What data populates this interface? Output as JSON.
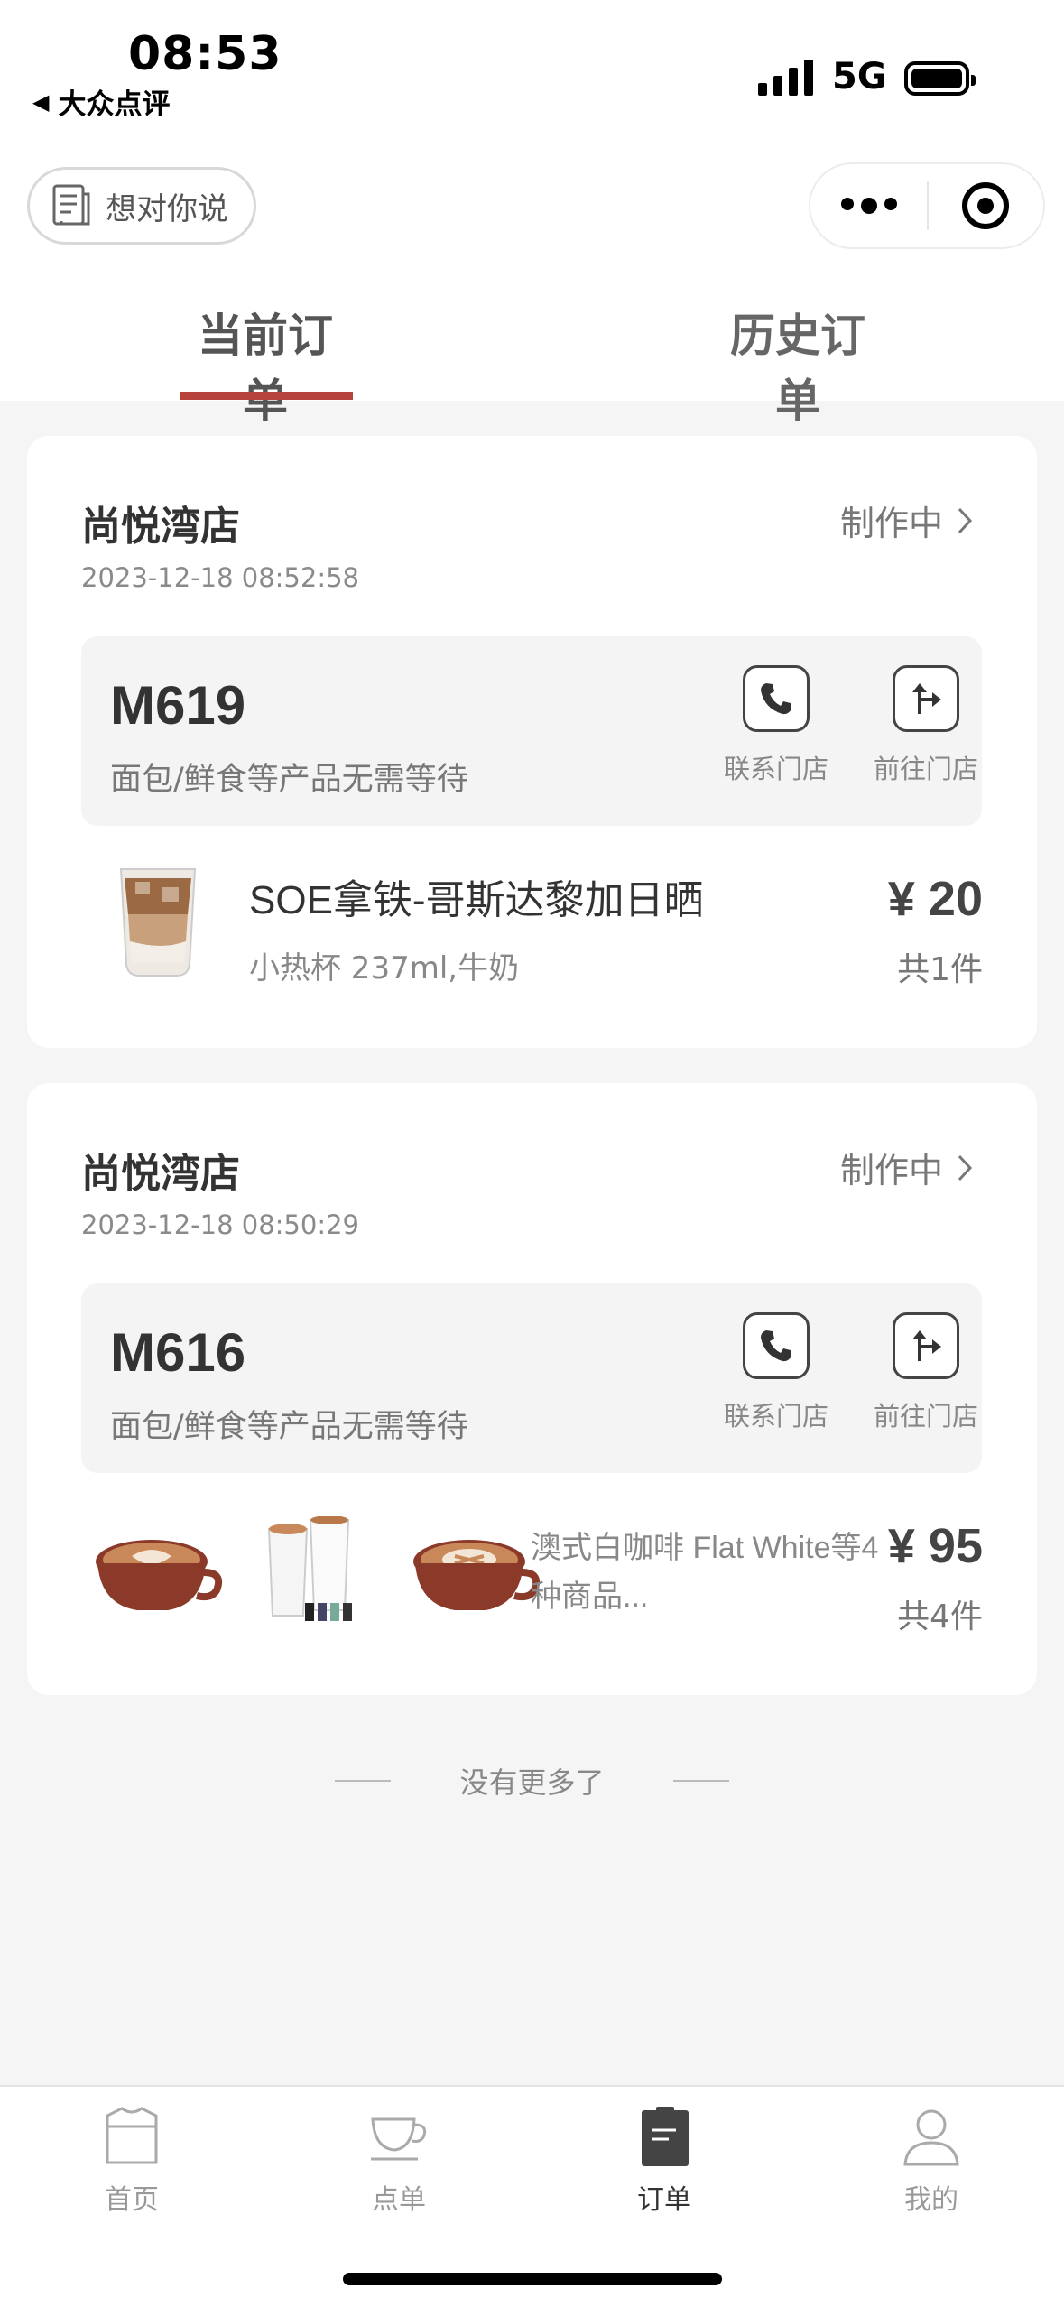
{
  "status_bar": {
    "time": "08:53",
    "back_app": "大众点评",
    "network": "5G"
  },
  "header": {
    "feedback_label": "想对你说"
  },
  "tabs": [
    {
      "label": "当前订单",
      "active": true
    },
    {
      "label": "历史订单",
      "active": false
    }
  ],
  "orders": [
    {
      "store": "尚悦湾店",
      "time": "2023-12-18 08:52:58",
      "status": "制作中",
      "code": "M619",
      "note": "面包/鲜食等产品无需等待",
      "call_label": "联系门店",
      "nav_label": "前往门店",
      "item_name": "SOE拿铁-哥斯达黎加日晒",
      "item_spec": "小热杯 237ml,牛奶",
      "price": "¥ 20",
      "qty": "共1件"
    },
    {
      "store": "尚悦湾店",
      "time": "2023-12-18 08:50:29",
      "status": "制作中",
      "code": "M616",
      "note": "面包/鲜食等产品无需等待",
      "call_label": "联系门店",
      "nav_label": "前往门店",
      "item_name": "澳式白咖啡 Flat White等4种商品...",
      "price": "¥ 95",
      "qty": "共4件"
    }
  ],
  "footer_text": "没有更多了",
  "bottom_nav": [
    {
      "label": "首页",
      "icon": "shirt-icon"
    },
    {
      "label": "点单",
      "icon": "cup-icon"
    },
    {
      "label": "订单",
      "icon": "order-icon",
      "active": true
    },
    {
      "label": "我的",
      "icon": "person-icon"
    }
  ],
  "colors": {
    "accent": "#b5433c",
    "background": "#f5f5f5"
  }
}
